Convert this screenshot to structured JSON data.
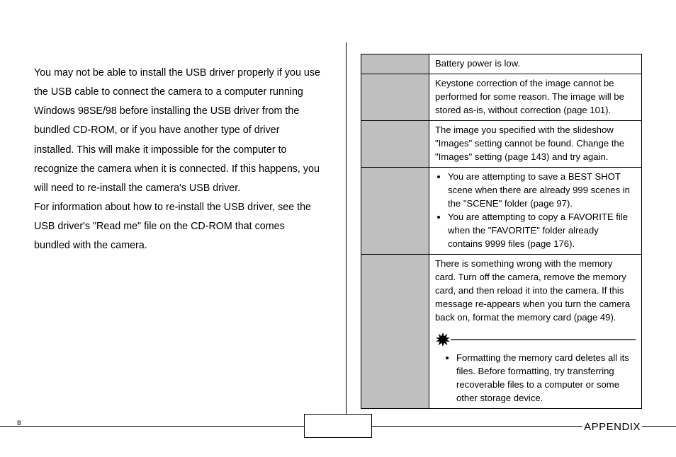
{
  "leftColumn": {
    "para1": "You may not be able to install the USB driver properly if you use the USB cable to connect the camera to a computer running Windows 98SE/98 before installing the USB driver from the bundled CD-ROM, or if you have another type of driver installed. This will make it impossible for the computer to recognize the camera when it is connected. If this happens, you will need to re-install the camera's USB driver.",
    "para2": "For information about how to re-install the USB driver, see the USB driver's \"Read me\" file on the CD-ROM that comes bundled with the camera."
  },
  "table": {
    "rows": [
      {
        "msg": "Battery power is low."
      },
      {
        "msg": "Keystone correction of the image cannot be performed for some reason. The image will be stored as-is, without correction (page 101)."
      },
      {
        "msg": "The image you specified with the slideshow \"Images\" setting cannot be found. Change the \"Images\" setting (page 143) and try again."
      },
      {
        "bullets": [
          "You are attempting to save a BEST SHOT scene when there are already 999 scenes in the \"SCENE\" folder (page 97).",
          "You are attempting to copy a FAVORITE file when the \"FAVORITE\" folder already contains 9999 files (page 176)."
        ]
      },
      {
        "msg": "There is something wrong with the memory card. Turn off the camera, remove the memory card, and then reload it into the camera. If this message re-appears when you turn the camera back on, format the memory card (page 49).",
        "importantBullets": [
          "Formatting the memory card deletes all its files. Before formatting, try transferring recoverable files to a computer or some other storage device."
        ]
      }
    ]
  },
  "footer": {
    "cornerMark": "B",
    "section": "APPENDIX"
  }
}
